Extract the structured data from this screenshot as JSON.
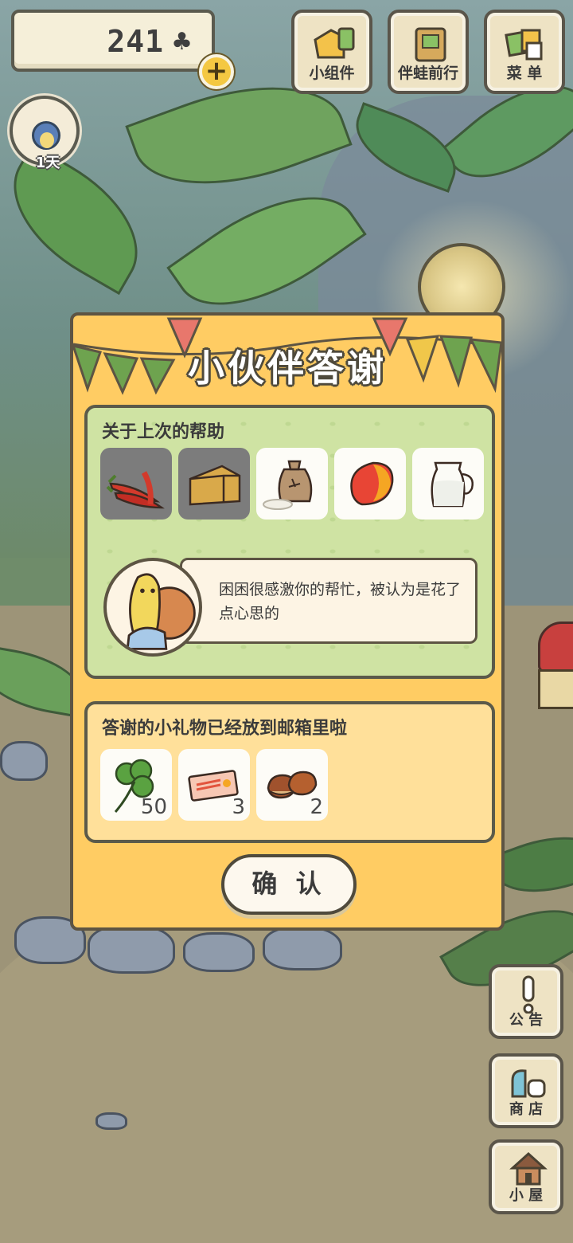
{
  "hud": {
    "clover_count": "241",
    "clover_symbol": "♣",
    "plus_symbol": "+",
    "days": "1天"
  },
  "top_buttons": [
    {
      "label": "小组件",
      "icon": "widget-icon"
    },
    {
      "label": "伴蛙前行",
      "icon": "journey-book-icon"
    },
    {
      "label": "菜 单",
      "icon": "menu-cards-icon"
    }
  ],
  "side_buttons": [
    {
      "label": "公 告",
      "icon": "exclamation-icon"
    },
    {
      "label": "商 店",
      "icon": "shop-bag-icon"
    },
    {
      "label": "小 屋",
      "icon": "house-icon"
    }
  ],
  "dialog": {
    "title": "小伙伴答谢",
    "help_heading": "关于上次的帮助",
    "help_items": [
      {
        "name": "red-peppers",
        "icon": "pepper-icon",
        "used": true
      },
      {
        "name": "cheese",
        "icon": "cheese-icon",
        "used": true
      },
      {
        "name": "rice-sack",
        "icon": "rice-sack-icon",
        "used": false
      },
      {
        "name": "mango",
        "icon": "mango-icon",
        "used": false
      },
      {
        "name": "milk-jug",
        "icon": "milk-jug-icon",
        "used": false
      }
    ],
    "message": "困困很感激你的帮忙，被认为是花了点心思的",
    "gift_heading": "答谢的小礼物已经放到邮箱里啦",
    "gifts": [
      {
        "icon": "clover-icon",
        "qty": "50"
      },
      {
        "icon": "ticket-icon",
        "qty": "3"
      },
      {
        "icon": "chestnut-icon",
        "qty": "2"
      }
    ],
    "confirm_label": "确 认"
  },
  "colors": {
    "dialog_bg": "#ffcc63",
    "help_panel_bg": "#cfe3a3",
    "gift_panel_bg": "#ffe09a",
    "outline": "#5d5443"
  }
}
